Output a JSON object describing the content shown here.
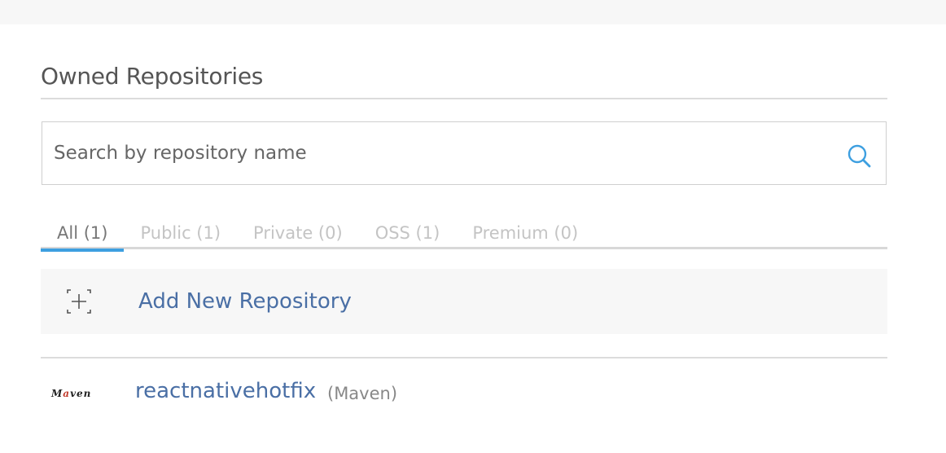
{
  "section": {
    "title": "Owned Repositories"
  },
  "search": {
    "placeholder": "Search by repository name"
  },
  "tabs": [
    {
      "label": "All (1)",
      "active": true
    },
    {
      "label": "Public (1)",
      "active": false
    },
    {
      "label": "Private (0)",
      "active": false
    },
    {
      "label": "OSS (1)",
      "active": false
    },
    {
      "label": "Premium (0)",
      "active": false
    }
  ],
  "add_repository": {
    "label": "Add New Repository"
  },
  "repositories": [
    {
      "name": "reactnativehotfix",
      "type": "(Maven)",
      "logo": "Maven"
    }
  ],
  "colors": {
    "accent": "#3d9fe0",
    "link": "#4a6fa5",
    "muted": "#c4c4c4"
  }
}
